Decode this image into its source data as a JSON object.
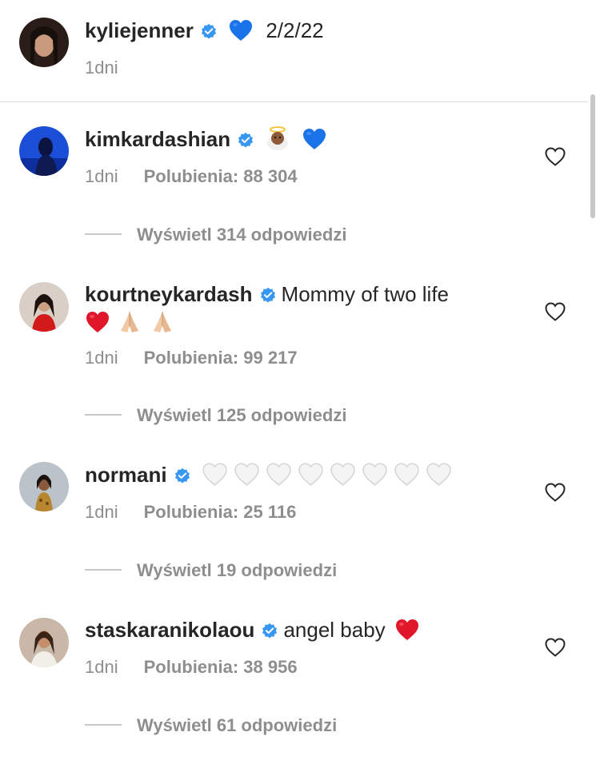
{
  "caption": {
    "username": "kyliejenner",
    "text": "2/2/22",
    "time": "1dni"
  },
  "comments": [
    {
      "username": "kimkardashian",
      "text": "",
      "time": "1dni",
      "likes": "Polubienia: 88 304",
      "replies": "Wyświetl 314 odpowiedzi"
    },
    {
      "username": "kourtneykardash",
      "text": "Mommy of two life",
      "time": "1dni",
      "likes": "Polubienia: 99 217",
      "replies": "Wyświetl 125 odpowiedzi"
    },
    {
      "username": "normani",
      "text": "",
      "time": "1dni",
      "likes": "Polubienia: 25 116",
      "replies": "Wyświetl 19 odpowiedzi"
    },
    {
      "username": "staskaranikolaou",
      "text": "angel baby",
      "time": "1dni",
      "likes": "Polubienia: 38 956",
      "replies": "Wyświetl 61 odpowiedzi"
    }
  ],
  "icons": {
    "verified": "verified-badge-icon",
    "like": "heart-outline-icon",
    "blue_heart": "blue-heart-emoji",
    "red_heart": "red-heart-emoji",
    "white_heart": "white-heart-emoji",
    "angel": "baby-angel-emoji",
    "pray": "folded-hands-emoji"
  },
  "colors": {
    "text": "#262626",
    "secondary": "#8e8e8e",
    "verified": "#3897f0",
    "divider": "#dbdbdb"
  }
}
